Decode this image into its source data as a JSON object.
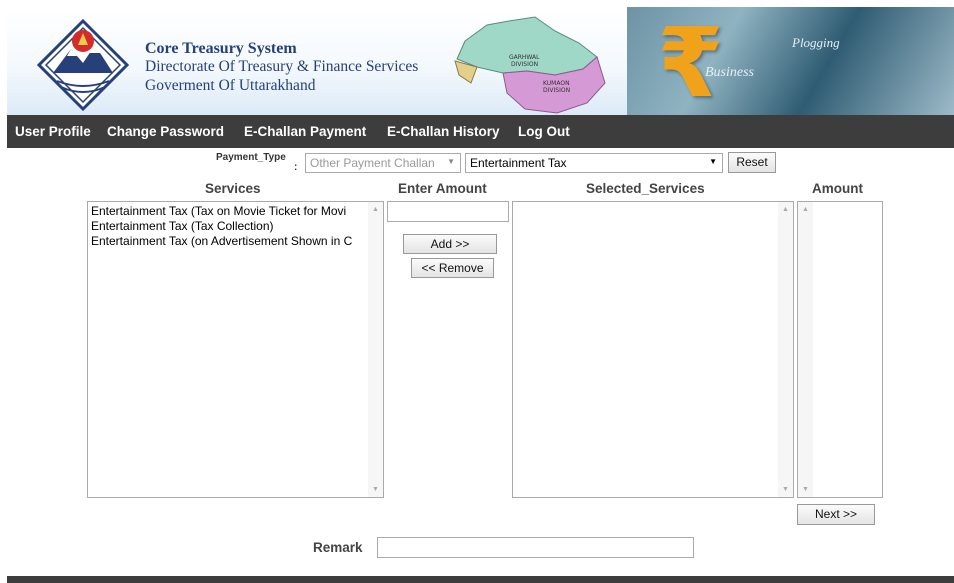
{
  "header": {
    "title": "Core Treasury System",
    "subtitle": "Directorate Of Treasury & Finance Services",
    "org": "Goverment Of Uttarakhand",
    "map_labels": {
      "garhwal": "GARHWAL",
      "garhwal_div": "DIVISION",
      "kumaon": "KUMAON",
      "kumaon_div": "DIVISION"
    },
    "banner_words": [
      "Business",
      "Plogging"
    ]
  },
  "nav": {
    "items": [
      "User Profile",
      "Change Password",
      "E-Challan Payment",
      "E-Challan History",
      "Log Out"
    ]
  },
  "form": {
    "payment_type_label": "Payment_Type",
    "payment_type_colon": ":",
    "payment_type_value": "Other Payment Challan",
    "tax_type_value": "Entertainment Tax",
    "reset_label": "Reset",
    "services_header": "Services",
    "enter_amount_header": "Enter Amount",
    "selected_services_header": "Selected_Services",
    "amount_header": "Amount",
    "services": [
      "Entertainment Tax (Tax on Movie Ticket for Movi",
      "Entertainment Tax (Tax Collection)",
      "Entertainment Tax (on Advertisement Shown in C"
    ],
    "amount_value": "",
    "add_label": "Add >>",
    "remove_label": "<< Remove",
    "next_label": "Next >>",
    "remark_label": "Remark",
    "remark_value": ""
  },
  "colors": {
    "nav_bg": "#3d3d3d",
    "title_blue": "#26407a",
    "rupee_gold": "#f0a21a"
  }
}
